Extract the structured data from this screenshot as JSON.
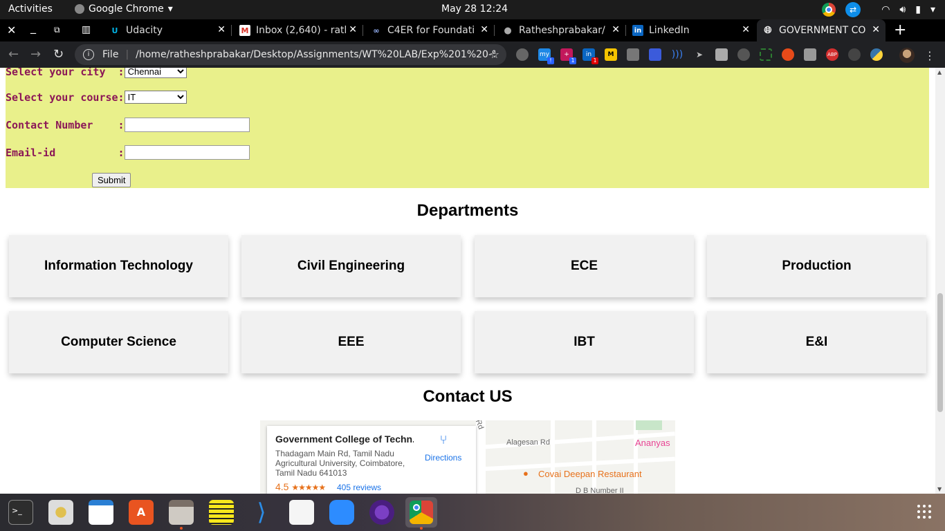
{
  "topbar": {
    "activities": "Activities",
    "app_name": "Google Chrome",
    "clock": "May 28  12:24"
  },
  "tabs": [
    {
      "title": "Udacity",
      "icon": "udacity-icon"
    },
    {
      "title": "Inbox (2,640) - rath",
      "icon": "gmail-icon"
    },
    {
      "title": "C4ER for Foundati",
      "icon": "link-icon"
    },
    {
      "title": "Ratheshprabakar/",
      "icon": "github-icon"
    },
    {
      "title": "LinkedIn",
      "icon": "linkedin-icon"
    },
    {
      "title": "GOVERNMENT CO",
      "icon": "globe-icon",
      "active": true
    }
  ],
  "omnibox": {
    "scheme": "File",
    "url": "/home/ratheshprabakar/Desktop/Assignments/WT%20LAB/Exp%201%20-%20..."
  },
  "form": {
    "city_label": "Select your city  :",
    "city_value": "Chennai",
    "course_label": "Select your course:",
    "course_value": "IT",
    "contact_label": "Contact Number    :",
    "email_label": "Email-id          :",
    "submit_label": "Submit"
  },
  "departments": {
    "heading": "Departments",
    "items": [
      "Information Technology",
      "Civil Engineering",
      "ECE",
      "Production",
      "Computer Science",
      "EEE",
      "IBT",
      "E&I"
    ]
  },
  "contact": {
    "heading": "Contact US"
  },
  "map": {
    "place_name": "Government College of Techn...",
    "address": "Thadagam Main Rd, Tamil Nadu Agricultural University, Coimbatore, Tamil Nadu 641013",
    "rating": "4.5",
    "stars": "★★★★★",
    "reviews": "405 reviews",
    "directions": "Directions",
    "street1": "Alagesan Rd",
    "poi1": "Ananyas",
    "poi2": "Covai Deepan Restaurant",
    "street2": "Rd",
    "street3": "D B Number II"
  },
  "colors": {
    "form_bg": "#e9f08b",
    "form_label": "#8b1757",
    "card_bg": "#f1f1f1"
  }
}
